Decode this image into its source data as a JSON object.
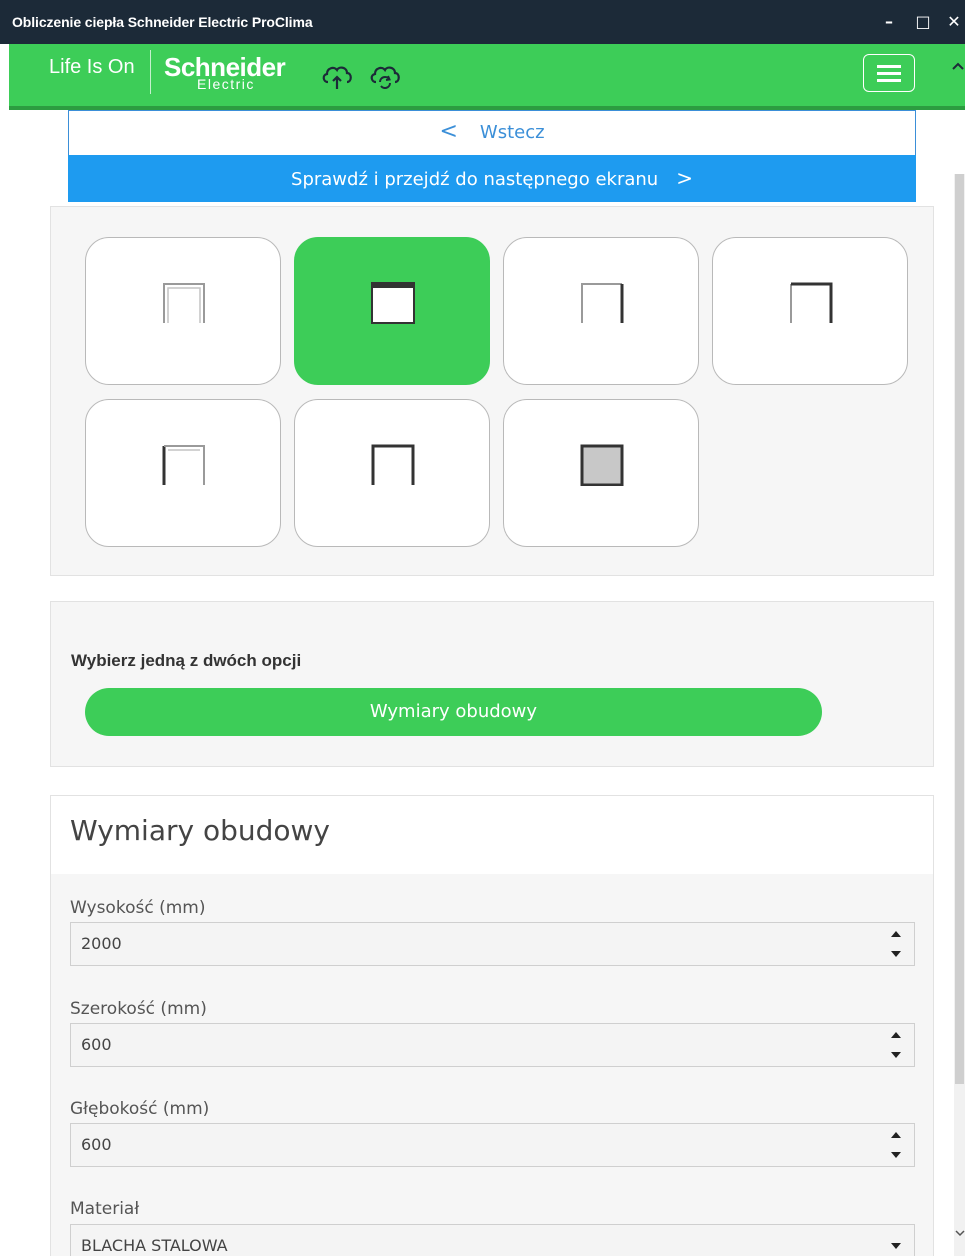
{
  "window": {
    "title": "Obliczenie ciepła Schneider Electric ProClima",
    "minimize_glyph": "–",
    "maximize_glyph": "□",
    "close_glyph": "✕"
  },
  "header": {
    "tagline": "Life Is On",
    "brand_top": "Schneider",
    "brand_bottom": "Electric",
    "icons": [
      "cloud-upload-icon",
      "cloud-sync-icon",
      "hamburger-menu-icon"
    ],
    "accent_color": "#3dcd58"
  },
  "nav": {
    "back_chevron": "<",
    "back_label": "Wstecz",
    "next_label": "Sprawdź i przejdź do następnego ekranu",
    "next_chevron": ">"
  },
  "enclosure_types": {
    "selected_index": 1,
    "tiles": [
      "enclosure-type-1",
      "enclosure-type-2",
      "enclosure-type-3",
      "enclosure-type-4",
      "enclosure-type-5",
      "enclosure-type-6",
      "enclosure-type-7"
    ]
  },
  "options": {
    "label": "Wybierz jedną z dwóch opcji",
    "button_label": "Wymiary obudowy"
  },
  "dimensions": {
    "title": "Wymiary obudowy",
    "height_label": "Wysokość (mm)",
    "height_value": "2000",
    "width_label": "Szerokość (mm)",
    "width_value": "600",
    "depth_label": "Głębokość (mm)",
    "depth_value": "600",
    "material_label": "Materiał",
    "material_value": "BLACHA STALOWA"
  }
}
